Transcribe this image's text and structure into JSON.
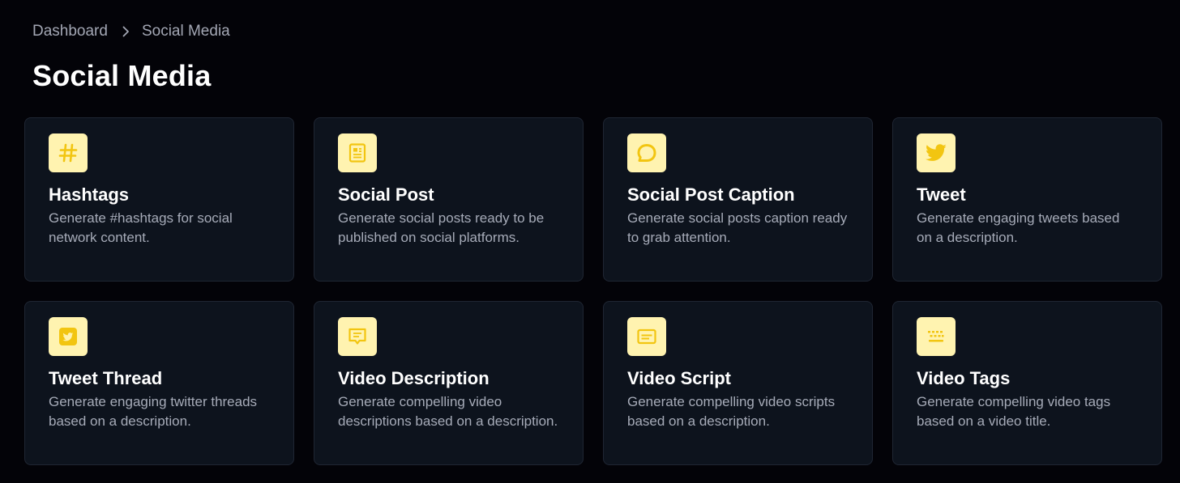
{
  "breadcrumb": {
    "items": [
      "Dashboard",
      "Social Media"
    ]
  },
  "page_title": "Social Media",
  "colors": {
    "background": "#030308",
    "card": "#0d131d",
    "card_border": "#1f2633",
    "icon_bg": "#fff3b0",
    "icon_fg": "#f2c511"
  },
  "cards": [
    {
      "title": "Hashtags",
      "description": "Generate #hashtags for social network content.",
      "icon": "hashtag-icon"
    },
    {
      "title": "Social Post",
      "description": "Generate social posts ready to be published on social platforms.",
      "icon": "article-icon"
    },
    {
      "title": "Social Post Caption",
      "description": "Generate social posts caption ready to grab attention.",
      "icon": "chat-bubble-icon"
    },
    {
      "title": "Tweet",
      "description": "Generate engaging tweets based on a description.",
      "icon": "twitter-icon"
    },
    {
      "title": "Tweet Thread",
      "description": "Generate engaging twitter threads based on a description.",
      "icon": "twitter-square-icon"
    },
    {
      "title": "Video Description",
      "description": "Generate compelling video descriptions based on a description.",
      "icon": "message-icon"
    },
    {
      "title": "Video Script",
      "description": "Generate compelling video scripts based on a description.",
      "icon": "subtitles-icon"
    },
    {
      "title": "Video Tags",
      "description": "Generate compelling video tags based on a video title.",
      "icon": "keyboard-icon"
    }
  ]
}
